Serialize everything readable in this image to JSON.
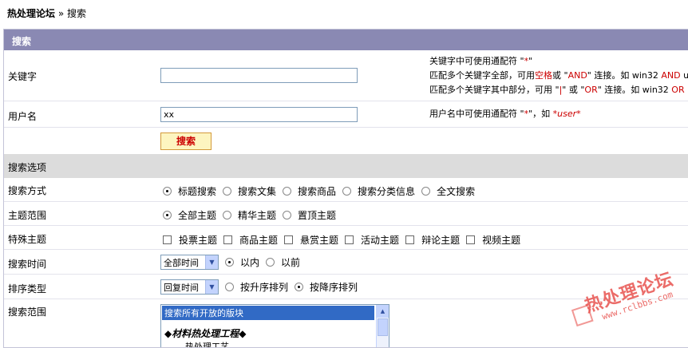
{
  "breadcrumb": {
    "forum": "热处理论坛",
    "sep": " » ",
    "page": "搜索"
  },
  "header": {
    "title": "搜索"
  },
  "keyword": {
    "label": "关键字",
    "value": "",
    "hint1": "关键字中可使用通配符 \"",
    "star": "*",
    "hint1_end": "\"",
    "hint2_a": "匹配多个关键字全部，可用",
    "hint2_red": "空格",
    "hint2_b": "或 \"",
    "hint2_and": "AND",
    "hint2_c": "\" 连接。如 win32 ",
    "hint2_and2": "AND",
    "hint2_d": " u",
    "hint3_a": "匹配多个关键字其中部分，可用 \"",
    "hint3_pipe": "|",
    "hint3_b": "\" 或 \"",
    "hint3_or": "OR",
    "hint3_c": "\" 连接。如 win32 ",
    "hint3_or2": "OR"
  },
  "username": {
    "label": "用户名",
    "value": "xx",
    "hint_a": "用户名中可使用通配符 \"",
    "star": "*",
    "hint_b": "\"，如 ",
    "example": "*user*"
  },
  "search_button": "搜索",
  "options_section": "搜索选项",
  "method": {
    "label": "搜索方式",
    "options": [
      "标题搜索",
      "搜索文集",
      "搜索商品",
      "搜索分类信息",
      "全文搜索"
    ],
    "selected": 0
  },
  "scope": {
    "label": "主题范围",
    "options": [
      "全部主题",
      "精华主题",
      "置顶主题"
    ],
    "selected": 0
  },
  "special": {
    "label": "特殊主题",
    "options": [
      "投票主题",
      "商品主题",
      "悬赏主题",
      "活动主题",
      "辩论主题",
      "视频主题"
    ]
  },
  "time": {
    "label": "搜索时间",
    "select": "全部时间",
    "options": [
      "以内",
      "以前"
    ],
    "selected": 0
  },
  "sort": {
    "label": "排序类型",
    "select": "回复时间",
    "options": [
      "按升序排列",
      "按降序排列"
    ],
    "selected": 1
  },
  "range": {
    "label": "搜索范围",
    "list_selected": "搜索所有开放的版块",
    "group": "◆材料热处理工程◆",
    "item": "热处理工艺"
  },
  "watermark": {
    "text": "热处理论坛",
    "url": "www.rclbbs.com"
  },
  "colors": {
    "header_bg": "#8a89b3",
    "section_bg": "#dcdcdc",
    "accent_red": "#cc0000",
    "button_bg": "#fdf5c0"
  }
}
